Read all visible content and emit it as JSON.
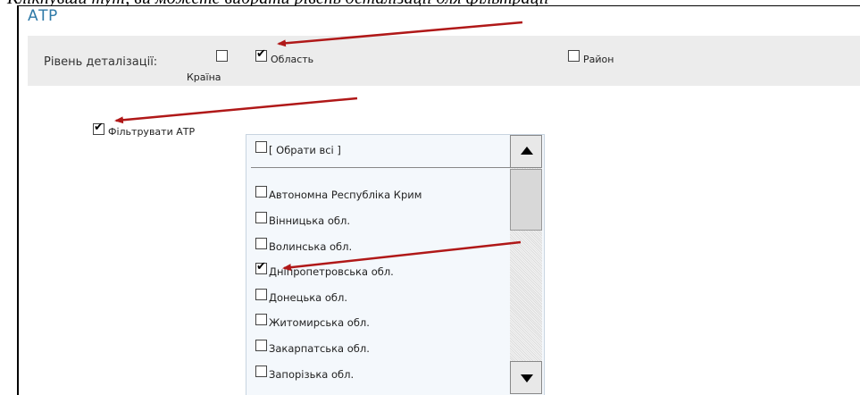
{
  "header_fragment": "Клікнувши тут, ви можете вибрати рівень деталізації для фільтрації",
  "section_title": "АТР",
  "detail_level": {
    "label": "Рівень деталізації:",
    "options": [
      {
        "label": "Країна",
        "checked": false
      },
      {
        "label": "Область",
        "checked": true
      },
      {
        "label": "Район",
        "checked": false
      }
    ]
  },
  "filter": {
    "label": "Фільтрувати АТР",
    "checked": true
  },
  "listbox": {
    "select_all": "[ Обрати всі ]",
    "items": [
      {
        "label": "Автономна Республіка Крим",
        "checked": false
      },
      {
        "label": "Вінницька обл.",
        "checked": false
      },
      {
        "label": "Волинська обл.",
        "checked": false
      },
      {
        "label": "Дніпропетровська обл.",
        "checked": true
      },
      {
        "label": "Донецька обл.",
        "checked": false
      },
      {
        "label": "Житомирська обл.",
        "checked": false
      },
      {
        "label": "Закарпатська обл.",
        "checked": false
      },
      {
        "label": "Запорізька обл.",
        "checked": false
      }
    ]
  },
  "colors": {
    "title": "#2f7aa8",
    "annotation_arrow": "#b01818",
    "detail_bar": "#ececec"
  }
}
